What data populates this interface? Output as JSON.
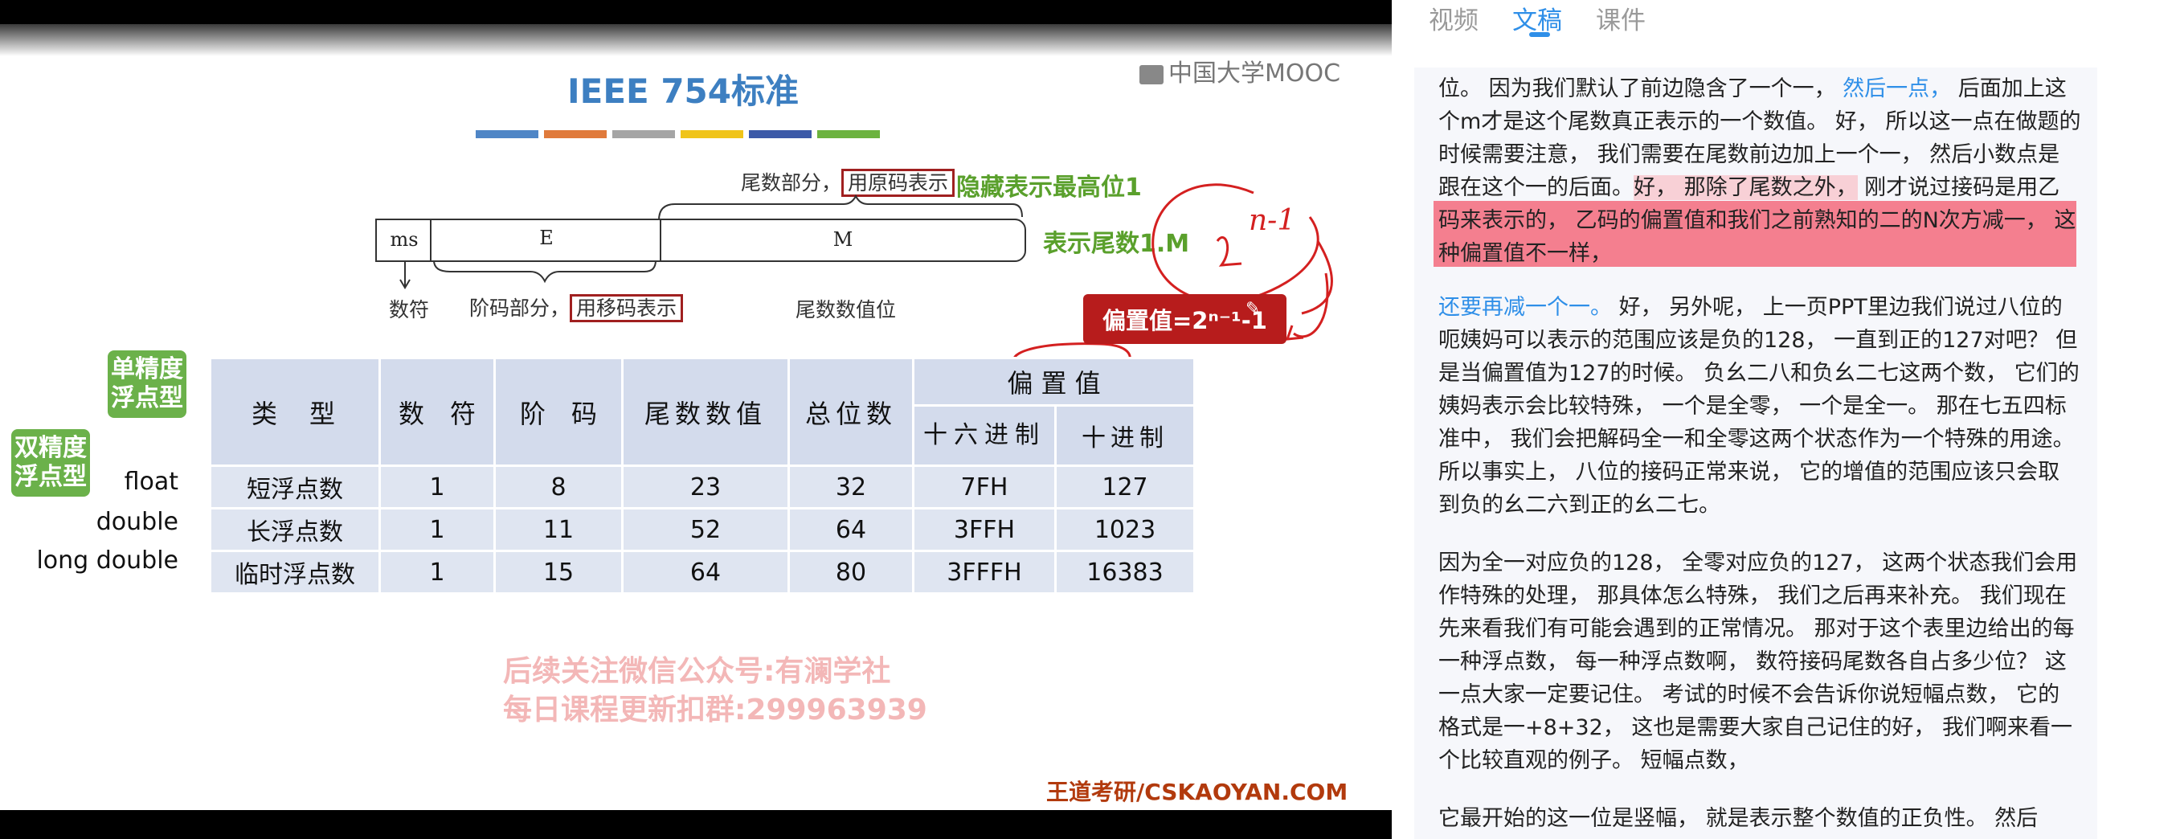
{
  "tabs": [
    "视频",
    "文稿",
    "课件"
  ],
  "slide": {
    "title": "IEEE 754标准",
    "logo": "中国大学MOOC",
    "color_bars": [
      "#4f86c6",
      "#e07a3b",
      "#a5a5a5",
      "#f0c419",
      "#3c5aa8",
      "#6cb33f"
    ],
    "fields": {
      "sign": "ms",
      "exponent": "E",
      "mantissa": "M"
    },
    "labels": {
      "mantissa_part": "尾数部分，",
      "mantissa_code": "用原码表示",
      "hidden_bit": "隐藏表示最高位1",
      "mantissa_form": "表示尾数1.M",
      "sign_label": "数符",
      "exponent_part": "阶码部分，",
      "exponent_code": "用移码表示",
      "mantissa_value": "尾数数值位"
    },
    "handwriting": "n-1",
    "bias_formula": "偏置值=2ⁿ⁻¹-1",
    "bias_header": "偏 置 值",
    "table": {
      "headers": [
        "类　型",
        "数　符",
        "阶　码",
        "尾数数值",
        "总位数",
        "十六进制",
        "十进制"
      ],
      "rows": [
        [
          "短浮点数",
          "1",
          "8",
          "23",
          "32",
          "7FH",
          "127"
        ],
        [
          "长浮点数",
          "1",
          "11",
          "52",
          "64",
          "3FFH",
          "1023"
        ],
        [
          "临时浮点数",
          "1",
          "15",
          "64",
          "80",
          "3FFFH",
          "16383"
        ]
      ]
    },
    "row_labels": [
      "float",
      "double",
      "long double"
    ],
    "bubbles": {
      "single": "单精度浮点型",
      "double": "双精度浮点型"
    },
    "watermark": [
      "后续关注微信公众号:有澜学社",
      "每日课程更新扣群:299963939"
    ],
    "footer": "王道考研/CSKAOYAN.COM"
  },
  "transcript": {
    "p1": {
      "a": "位。 因为我们默认了前边隐含了一个一， ",
      "b": "然后一点，",
      "c": " 后面加上这个m才是这个尾数真正表示的一个数值。 好， 所以这一点在做题的时候需要注意， 我们需要在尾数前边加上一个一， 然后小数点是跟在这个一的后面。",
      "d": "好， 那除了尾数之外，",
      "e": " 刚才说过接码是用乙码来表示的， 乙码的偏置值和我们之前熟知的二的N次方减一， 这种偏置值不一样，"
    },
    "p2": {
      "a": "还要再减一个一。",
      "b": " 好， 另外呢， 上一页PPT里边我们说过八位的呃姨妈可以表示的范围应该是负的128， 一直到正的127对吧？ 但是当偏置值为127的时候。 负幺二八和负幺二七这两个数， 它们的姨妈表示会比较特殊， 一个是全零， 一个是全一。 那在七五四标准中， 我们会把解码全一和全零这两个状态作为一个特殊的用途。 所以事实上， 八位的接码正常来说， 它的增值的范围应该只会取到负的幺二六到正的幺二七。"
    },
    "p3": "因为全一对应负的128， 全零对应负的127， 这两个状态我们会用作特殊的处理， 那具体怎么特殊， 我们之后再来补充。 我们现在先来看我们有可能会遇到的正常情况。 那对于这个表里边给出的每一种浮点数， 每一种浮点数啊， 数符接码尾数各自占多少位？ 这一点大家一定要记住。 考试的时候不会告诉你说短幅点数， 它的格式是一+8+32， 这也是需要大家自己记住的好， 我们啊来看一个比较直观的例子。 短幅点数，",
    "p4": "它最开始的这一位是竖幅， 就是表示整个数值的正负性。 然后"
  }
}
